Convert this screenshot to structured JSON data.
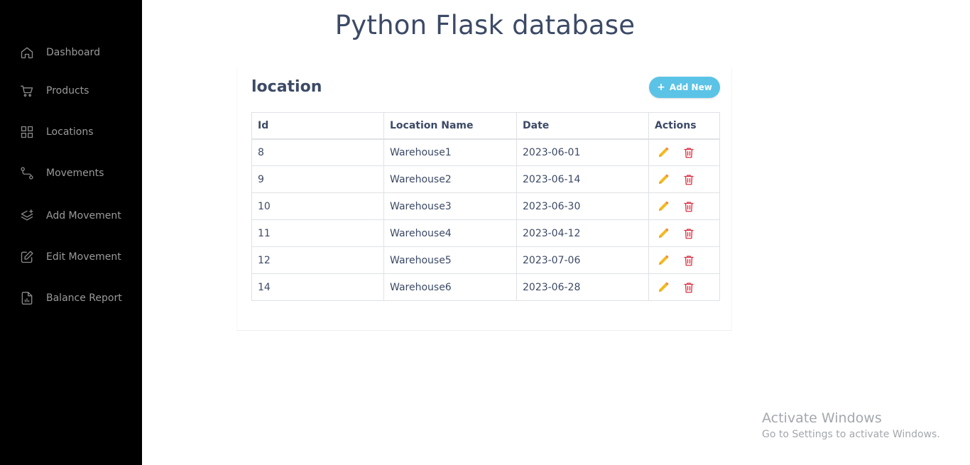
{
  "sidebar": {
    "items": [
      {
        "label": "Dashboard",
        "icon": "home-icon"
      },
      {
        "label": "Products",
        "icon": "cart-icon"
      },
      {
        "label": "Locations",
        "icon": "grid-icon"
      },
      {
        "label": "Movements",
        "icon": "route-icon"
      },
      {
        "label": "Add Movement",
        "icon": "layers-plus-icon"
      },
      {
        "label": "Edit Movement",
        "icon": "edit-square-icon"
      },
      {
        "label": "Balance Report",
        "icon": "report-file-icon"
      }
    ]
  },
  "page": {
    "title": "Python Flask database"
  },
  "card": {
    "title": "location",
    "add_button": "Add New"
  },
  "table": {
    "headers": [
      "Id",
      "Location Name",
      "Date",
      "Actions"
    ],
    "rows": [
      {
        "id": "8",
        "name": "Warehouse1",
        "date": "2023-06-01"
      },
      {
        "id": "9",
        "name": "Warehouse2",
        "date": "2023-06-14"
      },
      {
        "id": "10",
        "name": "Warehouse3",
        "date": "2023-06-30"
      },
      {
        "id": "11",
        "name": "Warehouse4",
        "date": "2023-04-12"
      },
      {
        "id": "12",
        "name": "Warehouse5",
        "date": "2023-07-06"
      },
      {
        "id": "14",
        "name": "Warehouse6",
        "date": "2023-06-28"
      }
    ]
  },
  "watermark": {
    "title": "Activate Windows",
    "subtitle": "Go to Settings to activate Windows."
  },
  "colors": {
    "sidebar_bg": "#000000",
    "accent": "#5bc3e6",
    "edit": "#f5b921",
    "delete": "#dc3545",
    "text": "#3c4a66"
  }
}
